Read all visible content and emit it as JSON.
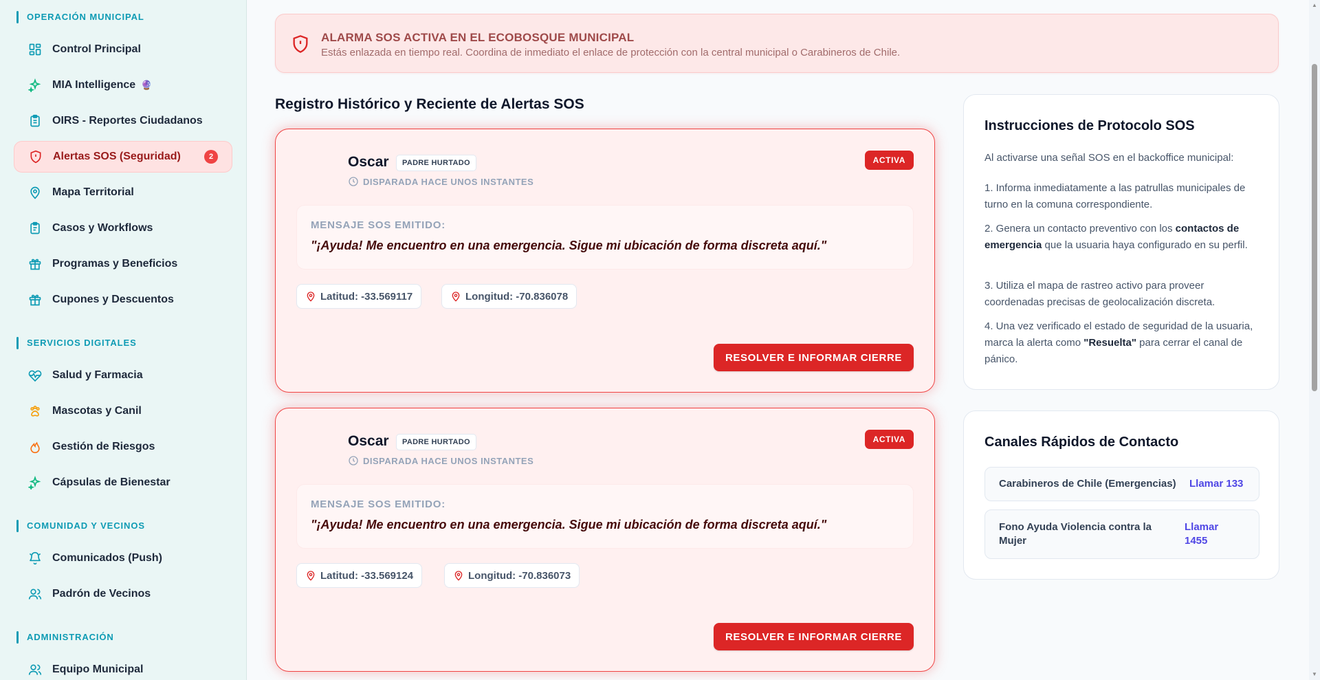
{
  "sidebar": {
    "sections": [
      {
        "title": "OPERACIÓN MUNICIPAL"
      },
      {
        "title": "SERVICIOS DIGITALES"
      },
      {
        "title": "COMUNIDAD Y VECINOS"
      },
      {
        "title": "ADMINISTRACIÓN"
      }
    ],
    "items": [
      {
        "label": "Control Principal",
        "icon": "dashboard-icon"
      },
      {
        "label": "MIA Intelligence",
        "icon": "sparkles-icon",
        "suffix": "🔮"
      },
      {
        "label": "OIRS - Reportes Ciudadanos",
        "icon": "clipboard-icon"
      },
      {
        "label": "Alertas SOS (Seguridad)",
        "icon": "shield-alert-icon",
        "badge": "2"
      },
      {
        "label": "Mapa Territorial",
        "icon": "map-pin-icon"
      },
      {
        "label": "Casos y Workflows",
        "icon": "clipboard-list-icon"
      },
      {
        "label": "Programas y Beneficios",
        "icon": "gift-icon"
      },
      {
        "label": "Cupones y Descuentos",
        "icon": "gift-icon"
      },
      {
        "label": "Salud y Farmacia",
        "icon": "heart-pulse-icon"
      },
      {
        "label": "Mascotas y Canil",
        "icon": "paw-icon"
      },
      {
        "label": "Gestión de Riesgos",
        "icon": "flame-icon"
      },
      {
        "label": "Cápsulas de Bienestar",
        "icon": "sparkles-icon"
      },
      {
        "label": "Comunicados (Push)",
        "icon": "bell-icon"
      },
      {
        "label": "Padrón de Vecinos",
        "icon": "users-icon"
      },
      {
        "label": "Equipo Municipal",
        "icon": "users-icon"
      }
    ]
  },
  "banner": {
    "title": "ALARMA SOS ACTIVA EN EL ECOBOSQUE MUNICIPAL",
    "subtitle": "Estás enlazada en tiempo real. Coordina de inmediato el enlace de protección con la central municipal o Carabineros de Chile."
  },
  "main": {
    "heading": "Registro Histórico y Reciente de Alertas SOS",
    "alerts": [
      {
        "name": "Oscar",
        "tag": "PADRE HURTADO",
        "time": "DISPARADA HACE UNOS INSTANTES",
        "status": "ACTIVA",
        "message_label": "MENSAJE SOS EMITIDO:",
        "message": "\"¡Ayuda! Me encuentro en una emergencia. Sigue mi ubicación de forma discreta aquí.\"",
        "lat": "Latitud: -33.569117",
        "lng": "Longitud: -70.836078",
        "action": "RESOLVER E INFORMAR CIERRE"
      },
      {
        "name": "Oscar",
        "tag": "PADRE HURTADO",
        "time": "DISPARADA HACE UNOS INSTANTES",
        "status": "ACTIVA",
        "message_label": "MENSAJE SOS EMITIDO:",
        "message": "\"¡Ayuda! Me encuentro en una emergencia. Sigue mi ubicación de forma discreta aquí.\"",
        "lat": "Latitud: -33.569124",
        "lng": "Longitud: -70.836073",
        "action": "RESOLVER E INFORMAR CIERRE"
      }
    ]
  },
  "protocol": {
    "title": "Instrucciones de Protocolo SOS",
    "intro": "Al activarse una señal SOS en el backoffice municipal:",
    "step1": "1. Informa inmediatamente a las patrullas municipales de turno en la comuna correspondiente.",
    "step2_a": "2. Genera un contacto preventivo con los ",
    "step2_b": "contactos de emergencia",
    "step2_c": " que la usuaria haya configurado en su perfil.",
    "step3": "3. Utiliza el mapa de rastreo activo para proveer coordenadas precisas de geolocalización discreta.",
    "step4_a": "4. Una vez verificado el estado de seguridad de la usuaria, marca la alerta como ",
    "step4_b": "\"Resuelta\"",
    "step4_c": " para cerrar el canal de pánico."
  },
  "contacts": {
    "title": "Canales Rápidos de Contacto",
    "items": [
      {
        "name": "Carabineros de Chile (Emergencias)",
        "action": "Llamar 133"
      },
      {
        "name": "Fono Ayuda Violencia contra la Mujer",
        "action": "Llamar 1455"
      }
    ]
  },
  "colors": {
    "accent": "#0e9bb4",
    "danger": "#dc2626",
    "link": "#4f46e5"
  }
}
